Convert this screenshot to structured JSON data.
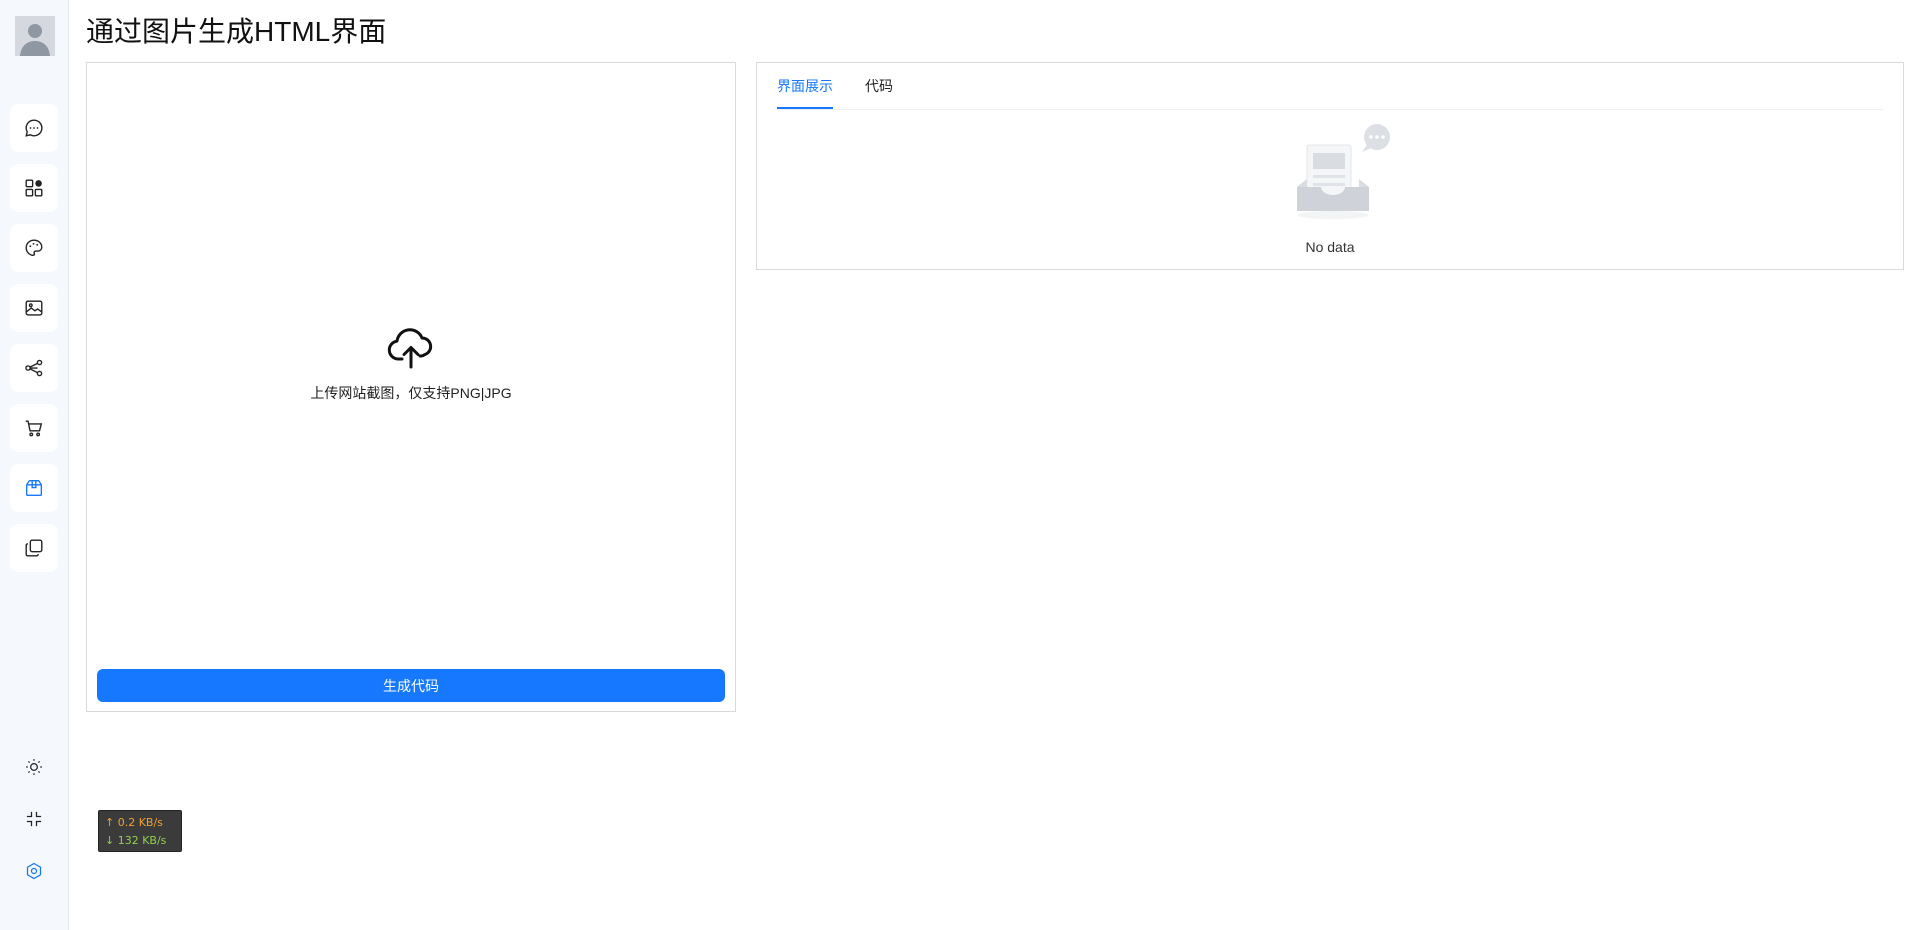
{
  "page": {
    "title": "通过图片生成HTML界面"
  },
  "sidebar": {
    "items": [
      {
        "icon": "chat-icon"
      },
      {
        "icon": "apps-icon"
      },
      {
        "icon": "palette-icon"
      },
      {
        "icon": "image-icon"
      },
      {
        "icon": "share-icon"
      },
      {
        "icon": "cart-icon"
      },
      {
        "icon": "box-icon",
        "active": true
      },
      {
        "icon": "copy-icon"
      }
    ],
    "bottom": [
      {
        "icon": "sun-icon"
      },
      {
        "icon": "collapse-icon"
      },
      {
        "icon": "settings-icon"
      }
    ]
  },
  "upload": {
    "hint": "上传网站截图，仅支持PNG|JPG",
    "button_label": "生成代码"
  },
  "preview": {
    "tabs": [
      {
        "label": "界面展示",
        "active": true
      },
      {
        "label": "代码",
        "active": false
      }
    ],
    "empty_text": "No data"
  },
  "network": {
    "upload": "↑ 0.2 KB/s",
    "download": "↓ 132 KB/s"
  },
  "colors": {
    "accent": "#1677ff",
    "sidebar_bg": "#f5f8fc",
    "net_up": "#f0a030",
    "net_down": "#8fd14f"
  }
}
